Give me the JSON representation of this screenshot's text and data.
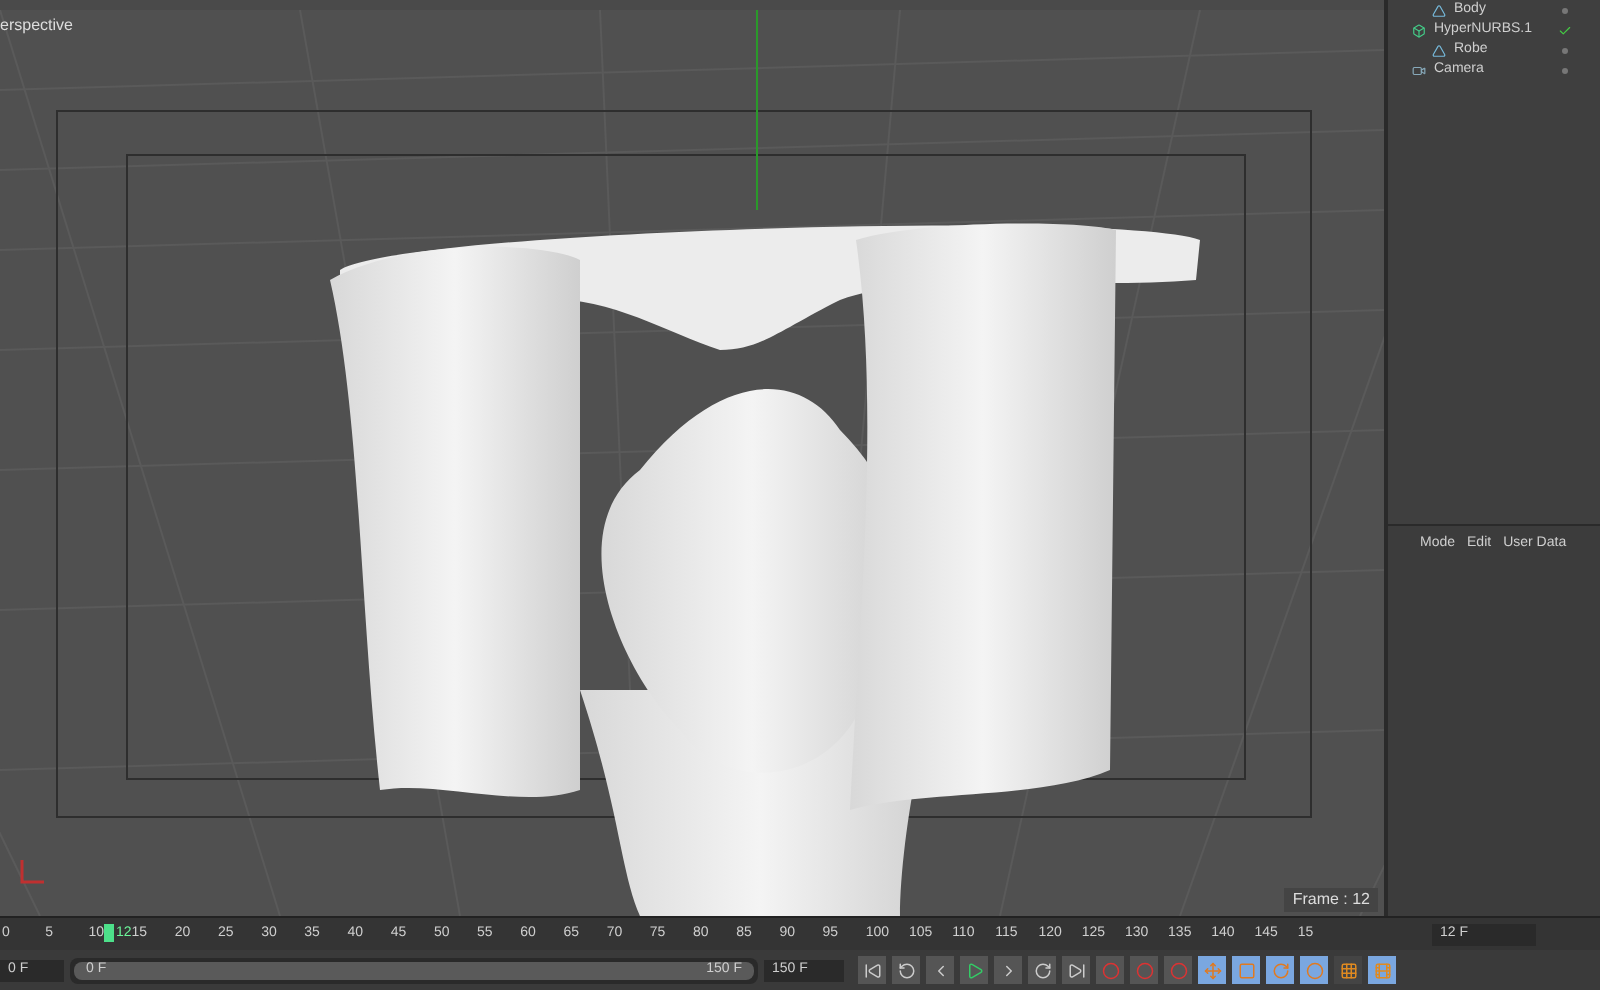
{
  "viewport": {
    "camera_label": "erspective",
    "frame_label": "Frame : 12"
  },
  "objects": [
    {
      "name": "Body",
      "kind": "mesh",
      "checked": false
    },
    {
      "name": "HyperNURBS.1",
      "kind": "nurbs",
      "checked": true
    },
    {
      "name": "Robe",
      "kind": "mesh",
      "checked": false
    },
    {
      "name": "Camera",
      "kind": "camera",
      "checked": false
    }
  ],
  "attributes_menu": [
    "Mode",
    "Edit",
    "User Data"
  ],
  "timeline": {
    "ticks": [
      "0",
      "5",
      "10",
      "15",
      "20",
      "25",
      "30",
      "35",
      "40",
      "45",
      "50",
      "55",
      "60",
      "65",
      "70",
      "75",
      "80",
      "85",
      "90",
      "95",
      "100",
      "105",
      "110",
      "115",
      "120",
      "125",
      "130",
      "135",
      "140",
      "145",
      "15"
    ],
    "current": "12",
    "level": 0.08,
    "current_field": "12 F"
  },
  "range": {
    "level": 1,
    "start_field": "0 F",
    "slider_start": "0 F",
    "slider_end": "150 F",
    "end_field": "150 F"
  }
}
